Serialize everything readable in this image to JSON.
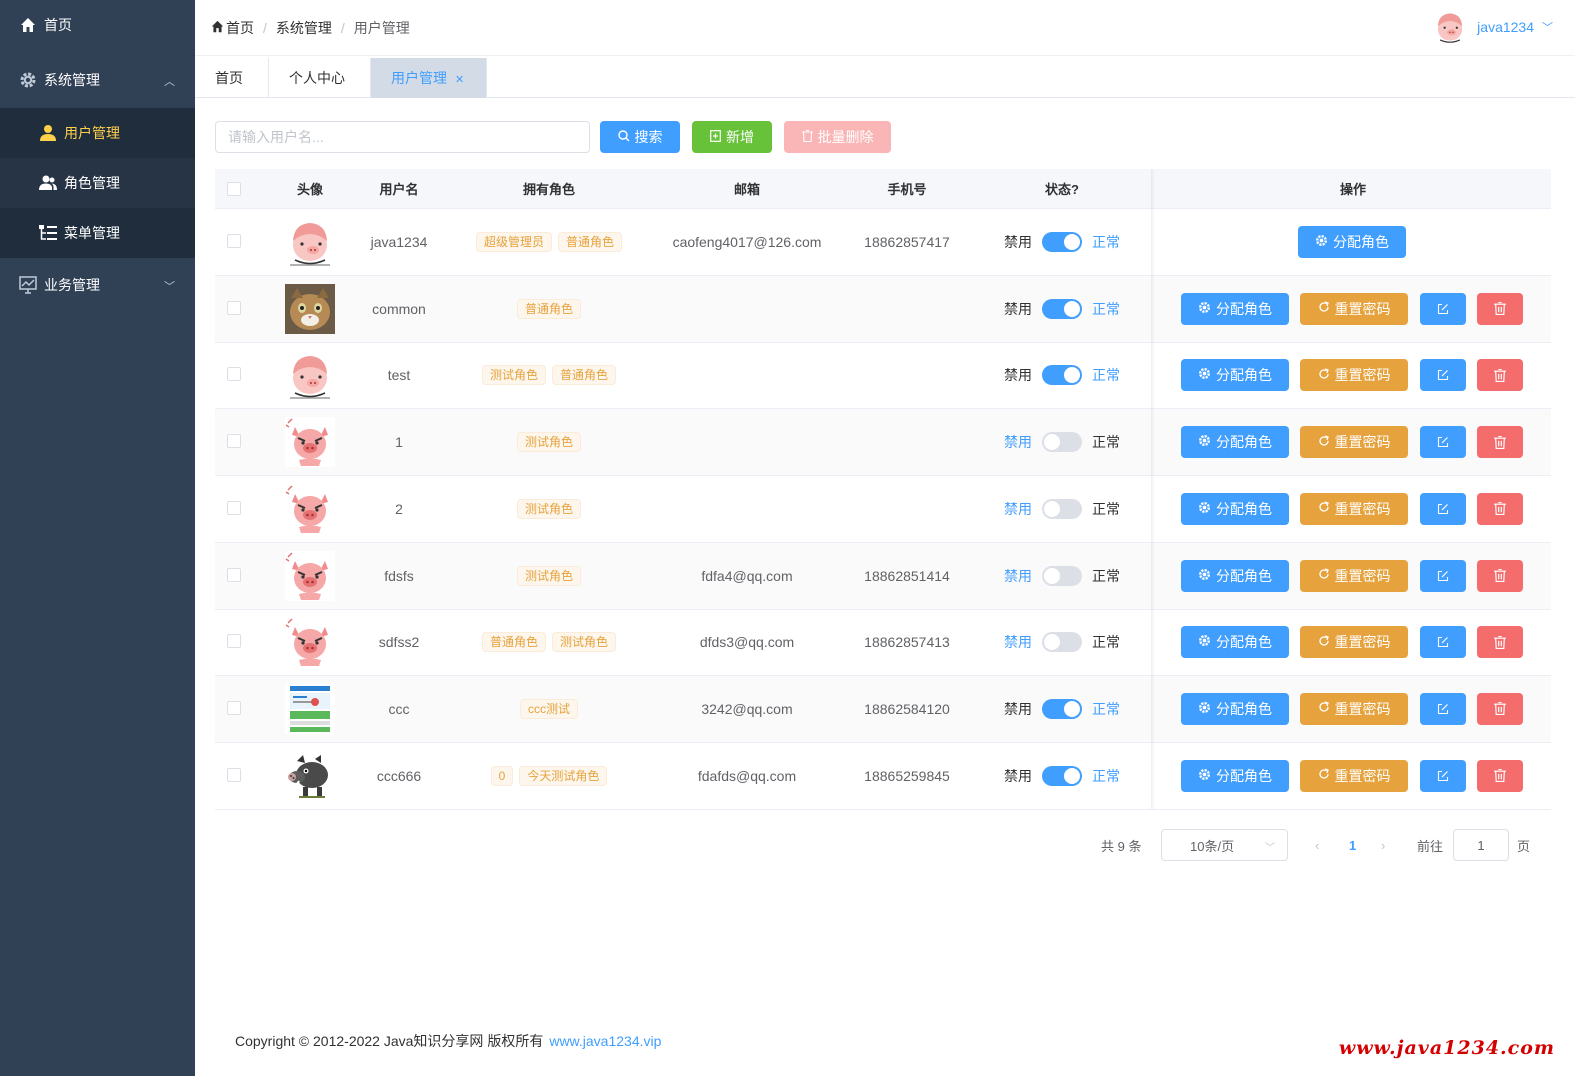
{
  "sidebar": {
    "home": "首页",
    "system": "系统管理",
    "users": "用户管理",
    "roles": "角色管理",
    "menus": "菜单管理",
    "business": "业务管理"
  },
  "header": {
    "breadcrumb": [
      "首页",
      "系统管理",
      "用户管理"
    ],
    "username": "java1234"
  },
  "tabs": [
    "首页",
    "个人中心",
    "用户管理"
  ],
  "toolbar": {
    "search_placeholder": "请输入用户名...",
    "search_label": "搜索",
    "add_label": "新增",
    "batch_delete_label": "批量删除"
  },
  "table": {
    "columns": [
      "头像",
      "用户名",
      "拥有角色",
      "邮箱",
      "手机号",
      "状态?",
      "操作"
    ],
    "status_off_label": "禁用",
    "status_on_label": "正常",
    "assign_label": "分配角色",
    "reset_label": "重置密码",
    "rows": [
      {
        "avatar": "pig-helmet",
        "username": "java1234",
        "roles": [
          "超级管理员",
          "普通角色"
        ],
        "email": "caofeng4017@126.com",
        "phone": "18862857417",
        "enabled": true
      },
      {
        "avatar": "cat",
        "username": "common",
        "roles": [
          "普通角色"
        ],
        "email": "",
        "phone": "",
        "enabled": true
      },
      {
        "avatar": "pig-helmet",
        "username": "test",
        "roles": [
          "测试角色",
          "普通角色"
        ],
        "email": "",
        "phone": "",
        "enabled": true
      },
      {
        "avatar": "angry-pig",
        "username": "1",
        "roles": [
          "测试角色"
        ],
        "email": "",
        "phone": "",
        "enabled": false
      },
      {
        "avatar": "angry-pig",
        "username": "2",
        "roles": [
          "测试角色"
        ],
        "email": "",
        "phone": "",
        "enabled": false
      },
      {
        "avatar": "angry-pig",
        "username": "fdsfs",
        "roles": [
          "测试角色"
        ],
        "email": "fdfa4@qq.com",
        "phone": "18862851414",
        "enabled": false
      },
      {
        "avatar": "angry-pig",
        "username": "sdfss2",
        "roles": [
          "普通角色",
          "测试角色"
        ],
        "email": "dfds3@qq.com",
        "phone": "18862857413",
        "enabled": false
      },
      {
        "avatar": "screenshot",
        "username": "ccc",
        "roles": [
          "ccc测试"
        ],
        "email": "3242@qq.com",
        "phone": "18862584120",
        "enabled": true
      },
      {
        "avatar": "boar",
        "username": "ccc666",
        "roles": [
          "0",
          "今天测试角色"
        ],
        "email": "fdafds@qq.com",
        "phone": "18865259845",
        "enabled": true
      }
    ]
  },
  "pagination": {
    "total": "共 9 条",
    "page_size": "10条/页",
    "current": "1",
    "goto_label": "前往",
    "goto_value": "1",
    "page_unit": "页"
  },
  "footer": {
    "copyright": "Copyright © 2012-2022 Java知识分享网 版权所有",
    "link": "www.java1234.vip"
  },
  "watermark": "www.java1234.com",
  "colors": {
    "sidebar_bg": "#304156",
    "primary": "#409eff",
    "success": "#67c23a",
    "warning": "#e6a23c",
    "danger": "#f56c6c",
    "active_menu": "#ffd04b"
  }
}
